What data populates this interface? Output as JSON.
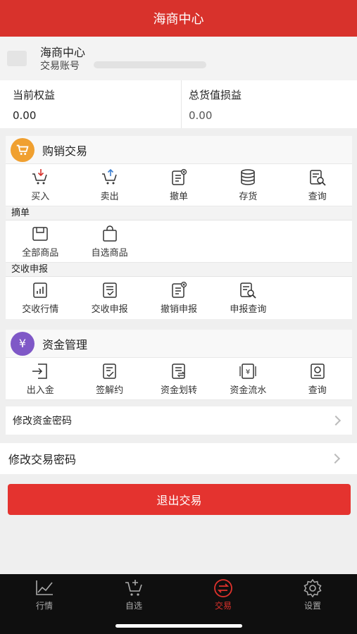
{
  "header": {
    "title": "海商中心"
  },
  "account": {
    "name": "海商中心",
    "account_label": "交易账号"
  },
  "summary": [
    {
      "label": "当前权益",
      "value": "0.00"
    },
    {
      "label": "总货值损益",
      "value": "0.00"
    }
  ],
  "trade": {
    "title": "购销交易",
    "badge_icon": "cart-icon",
    "badge_color": "#f0a030",
    "actions": [
      {
        "label": "买入",
        "icon": "cart-buy-icon",
        "color": "#d8322c"
      },
      {
        "label": "卖出",
        "icon": "cart-sell-icon",
        "color": "#3c7fd0"
      },
      {
        "label": "撤单",
        "icon": "cancel-order-icon",
        "color": "#333333"
      },
      {
        "label": "存货",
        "icon": "inventory-icon",
        "color": "#333333"
      },
      {
        "label": "查询",
        "icon": "query-icon",
        "color": "#333333"
      }
    ],
    "listing": {
      "title": "摘单",
      "actions": [
        {
          "label": "全部商品",
          "icon": "all-goods-icon"
        },
        {
          "label": "自选商品",
          "icon": "selected-goods-icon"
        }
      ]
    },
    "delivery": {
      "title": "交收申报",
      "actions": [
        {
          "label": "交收行情",
          "icon": "delivery-market-icon"
        },
        {
          "label": "交收申报",
          "icon": "delivery-declare-icon"
        },
        {
          "label": "撤销申报",
          "icon": "cancel-declare-icon"
        },
        {
          "label": "申报查询",
          "icon": "declare-query-icon"
        }
      ]
    }
  },
  "funds": {
    "title": "资金管理",
    "badge_icon": "yuan-icon",
    "badge_symbol": "¥",
    "badge_color": "#7f58c7",
    "actions": [
      {
        "label": "出入金",
        "icon": "deposit-withdraw-icon"
      },
      {
        "label": "签解约",
        "icon": "sign-contract-icon"
      },
      {
        "label": "资金划转",
        "icon": "fund-transfer-icon"
      },
      {
        "label": "资金流水",
        "icon": "fund-flow-icon"
      },
      {
        "label": "查询",
        "icon": "fund-query-icon"
      }
    ],
    "change_fund_password": "修改资金密码"
  },
  "change_trade_password": "修改交易密码",
  "logout": "退出交易",
  "tabbar": [
    {
      "label": "行情",
      "icon": "chart-icon",
      "active": false
    },
    {
      "label": "自选",
      "icon": "cart-add-icon",
      "active": false
    },
    {
      "label": "交易",
      "icon": "exchange-icon",
      "active": true
    },
    {
      "label": "设置",
      "icon": "gear-icon",
      "active": false
    }
  ],
  "colors": {
    "brand_red": "#d8322c",
    "logout_red": "#e4332f"
  }
}
